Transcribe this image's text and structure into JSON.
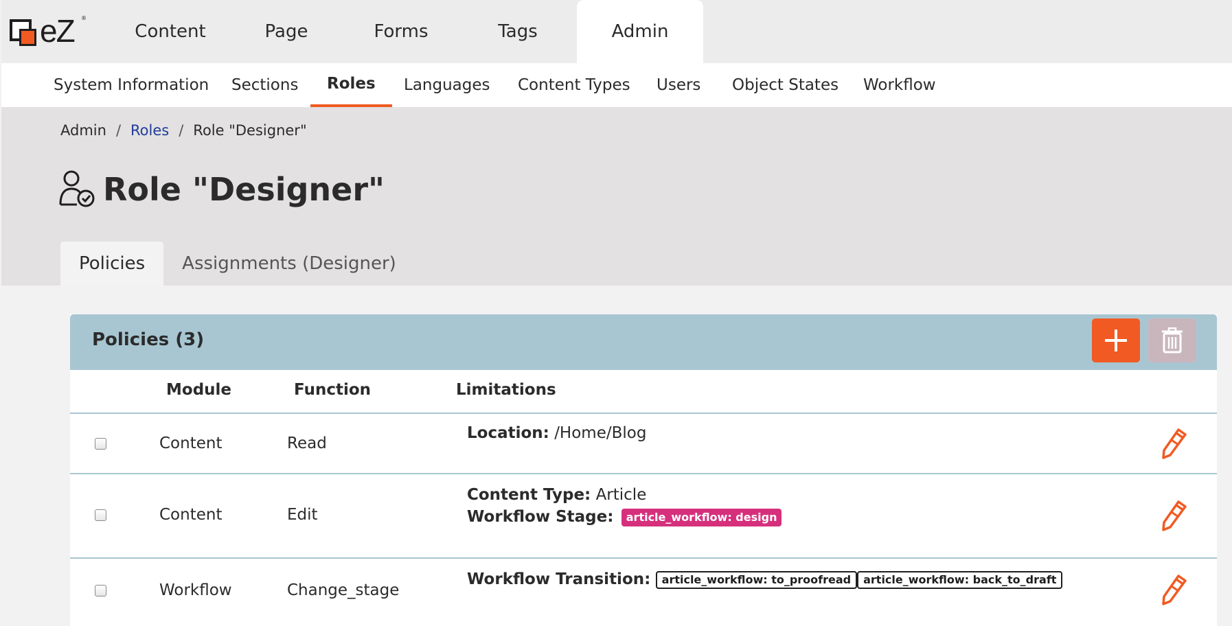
{
  "logo": {
    "text": "eZ",
    "reg": "®"
  },
  "topnav": [
    {
      "label": "Content"
    },
    {
      "label": "Page"
    },
    {
      "label": "Forms"
    },
    {
      "label": "Tags"
    },
    {
      "label": "Admin"
    }
  ],
  "subnav": [
    {
      "label": "System Information"
    },
    {
      "label": "Sections"
    },
    {
      "label": "Roles"
    },
    {
      "label": "Languages"
    },
    {
      "label": "Content Types"
    },
    {
      "label": "Users"
    },
    {
      "label": "Object States"
    },
    {
      "label": "Workflow"
    }
  ],
  "breadcrumb": {
    "root": "Admin",
    "link": "Roles",
    "current": "Role \"Designer\"",
    "separator": "/"
  },
  "page_title": "Role \"Designer\"",
  "tabs": [
    {
      "label": "Policies"
    },
    {
      "label": "Assignments (Designer)"
    }
  ],
  "policies": {
    "title": "Policies (3)",
    "columns": {
      "module": "Module",
      "function": "Function",
      "limitations": "Limitations"
    },
    "rows": [
      {
        "module": "Content",
        "function": "Read",
        "limit1_label": "Location:",
        "limit1_value": "/Home/Blog"
      },
      {
        "module": "Content",
        "function": "Edit",
        "limit1_label": "Content Type:",
        "limit1_value": "Article",
        "limit2_label": "Workflow Stage:",
        "limit2_badge": "article_workflow: design"
      },
      {
        "module": "Workflow",
        "function": "Change_stage",
        "limit1_label": "Workflow Transition:",
        "limit1_badge1": "article_workflow: to_proofread",
        "limit1_badge2": "article_workflow: back_to_draft"
      }
    ]
  },
  "colors": {
    "accent": "#f15a22",
    "panel_header": "#a8c6d2",
    "badge_pink": "#d6307d",
    "link": "#1f3c9a"
  }
}
